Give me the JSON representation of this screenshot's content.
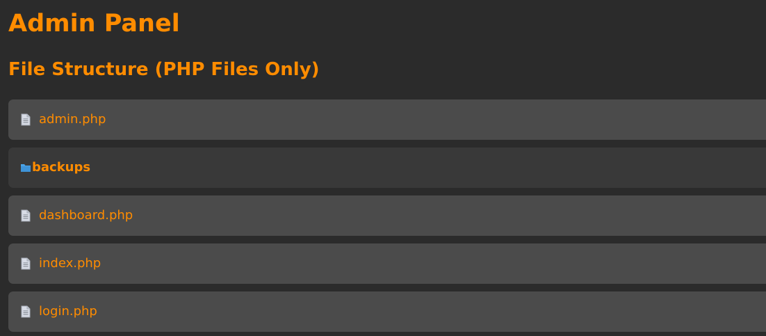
{
  "page": {
    "title": "Admin Panel",
    "section_title": "File Structure (PHP Files Only)"
  },
  "items": [
    {
      "type": "file",
      "name": "admin.php",
      "icon": "file-icon"
    },
    {
      "type": "folder",
      "name": "backups",
      "icon": "folder-icon"
    },
    {
      "type": "file",
      "name": "dashboard.php",
      "icon": "file-icon"
    },
    {
      "type": "file",
      "name": "index.php",
      "icon": "file-icon"
    },
    {
      "type": "file",
      "name": "login.php",
      "icon": "file-icon"
    }
  ],
  "colors": {
    "accent": "#ff8c00",
    "background": "#2b2b2b",
    "file_row": "#4b4b4b",
    "folder_row": "#393939",
    "folder_icon": "#4aa3e6",
    "file_icon": "#d8dce6"
  }
}
